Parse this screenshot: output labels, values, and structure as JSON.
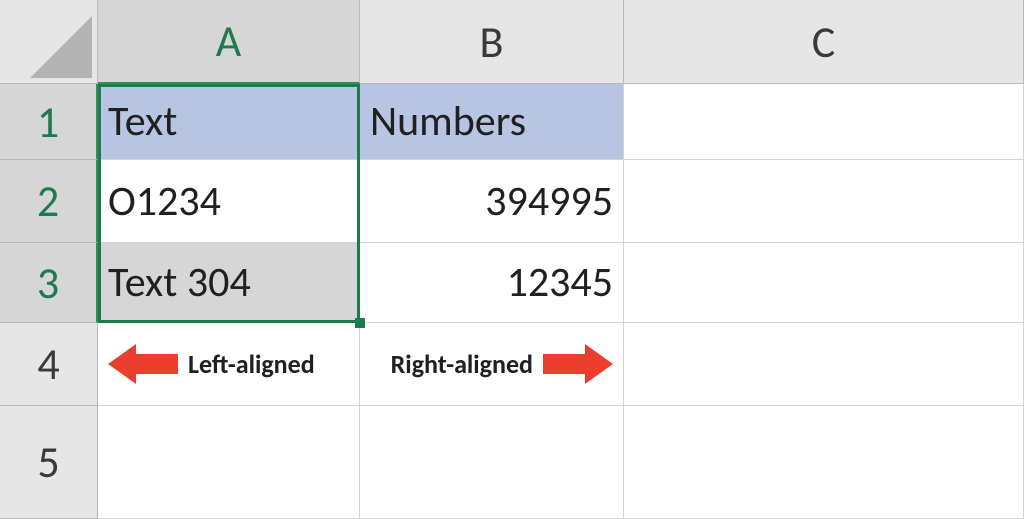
{
  "columns": {
    "A": "A",
    "B": "B",
    "C": "C"
  },
  "rows": {
    "r1": "1",
    "r2": "2",
    "r3": "3",
    "r4": "4",
    "r5": "5"
  },
  "headers": {
    "A": "Text",
    "B": "Numbers"
  },
  "data": {
    "A2": "O1234",
    "A3": "Text 304",
    "B2": "394995",
    "B3": "12345"
  },
  "annotations": {
    "left": "Left-aligned",
    "right": "Right-aligned"
  },
  "selection": {
    "range": "A1:A3",
    "active": "A1"
  }
}
